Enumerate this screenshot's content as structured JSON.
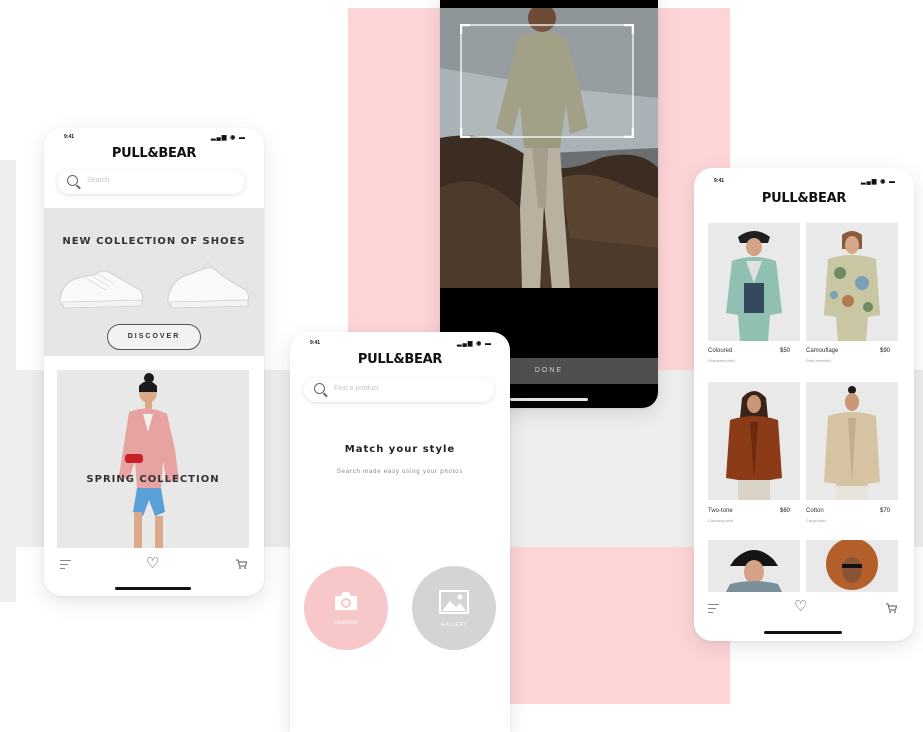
{
  "common": {
    "brand": "PULL&BEAR",
    "status_time": "9:41",
    "status_icons": "▂▄▆ ◉ ▬"
  },
  "phone_home": {
    "search_placeholder": "Search",
    "banner_title": "NEW COLLECTION OF SHOES",
    "discover_label": "DISCOVER",
    "collection_title": "SPRING COLLECTION"
  },
  "phone_camera": {
    "done_label": "DONE"
  },
  "phone_match": {
    "search_placeholder": "Find a product",
    "heading": "Match your style",
    "subtitle": "Search made easy using your photos",
    "camera_label": "CAMERA",
    "gallery_label": "GALLERY"
  },
  "phone_products": {
    "products": [
      {
        "name": "Coloured",
        "sub": "Oversized shirt",
        "price": "$50"
      },
      {
        "name": "Camouflage",
        "sub": "Print overshirt",
        "price": "$90"
      },
      {
        "name": "Two-tone",
        "sub": "Corduroy shirt",
        "price": "$60"
      },
      {
        "name": "Cotton",
        "sub": "Cargo shirt",
        "price": "$70"
      }
    ]
  },
  "colors": {
    "pink": "#fdd5d7",
    "grey_band": "#eeeeee",
    "camera_button": "#f8c7ca",
    "gallery_button": "#d4d4d4"
  }
}
